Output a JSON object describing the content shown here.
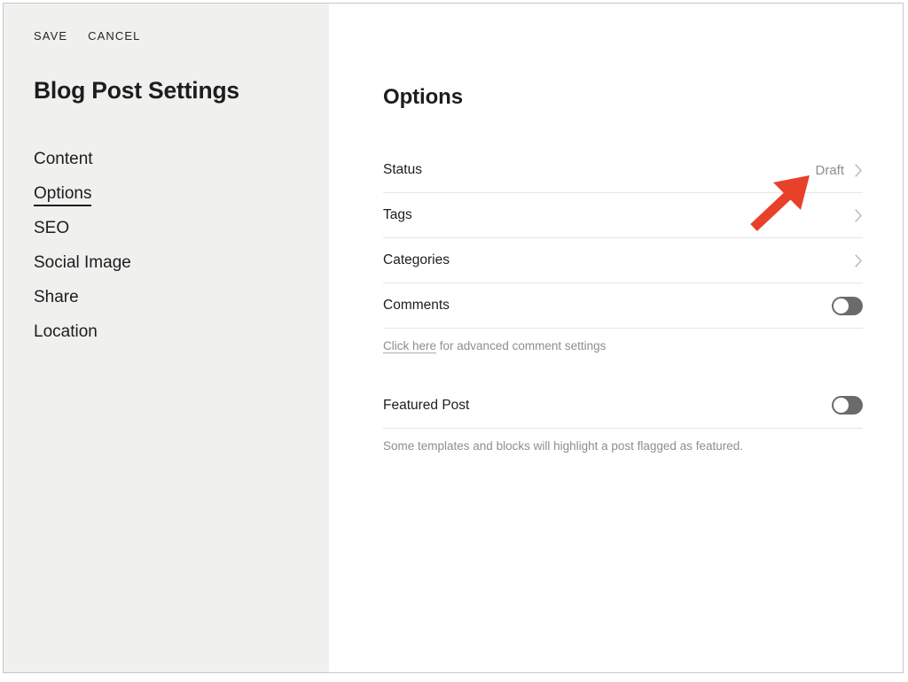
{
  "window": {
    "sidebar": {
      "actions": [
        {
          "label": "SAVE",
          "name": "save-button"
        },
        {
          "label": "CANCEL",
          "name": "cancel-button"
        }
      ],
      "title": "Blog Post Settings",
      "nav_items": [
        {
          "label": "Content",
          "active": false
        },
        {
          "label": "Options",
          "active": true
        },
        {
          "label": "SEO",
          "active": false
        },
        {
          "label": "Social Image",
          "active": false
        },
        {
          "label": "Share",
          "active": false
        },
        {
          "label": "Location",
          "active": false
        }
      ]
    },
    "main": {
      "title": "Options",
      "rows": {
        "status": {
          "label": "Status",
          "value": "Draft",
          "control": "chevron-right-icon"
        },
        "tags": {
          "label": "Tags",
          "control": "chevron-right-icon"
        },
        "categories": {
          "label": "Categories",
          "control": "chevron-right-icon"
        },
        "comments": {
          "label": "Comments",
          "control": "toggle",
          "state": "off"
        },
        "featured": {
          "label": "Featured Post",
          "control": "toggle",
          "state": "off"
        }
      },
      "comments_helper": {
        "link_text": "Click here",
        "rest_text": " for advanced comment settings"
      },
      "featured_helper": {
        "text": "Some templates and blocks will highlight a post flagged as featured."
      }
    },
    "annotation": {
      "arrow_color": "#E8412A",
      "points_at": "Status"
    }
  }
}
